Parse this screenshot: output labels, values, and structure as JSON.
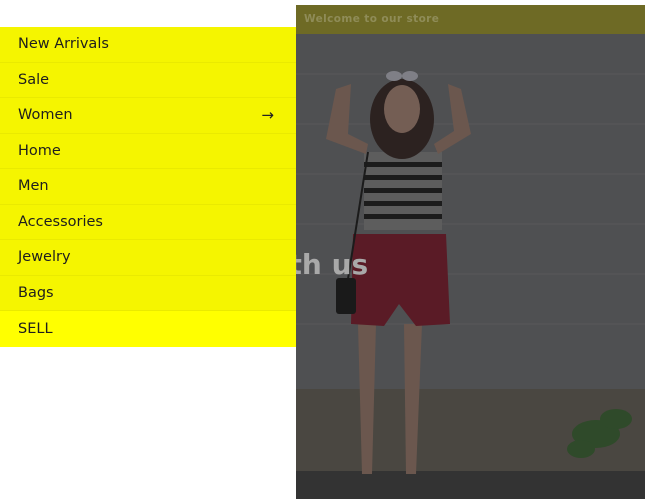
{
  "announcement": {
    "text": "Welcome to our store"
  },
  "hero": {
    "heading": "ess with us"
  },
  "menu": {
    "items": [
      {
        "label": "New Arrivals",
        "has_submenu": false
      },
      {
        "label": "Sale",
        "has_submenu": false
      },
      {
        "label": "Women",
        "has_submenu": true,
        "submenu_icon": "arrow-right-icon"
      },
      {
        "label": "Home",
        "has_submenu": false
      },
      {
        "label": "Men",
        "has_submenu": false
      },
      {
        "label": "Accessories",
        "has_submenu": false
      },
      {
        "label": "Jewelry",
        "has_submenu": false
      },
      {
        "label": "Bags",
        "has_submenu": false
      },
      {
        "label": "SELL",
        "has_submenu": false,
        "active": true
      }
    ]
  },
  "colors": {
    "drawer_bg": "#f5f500",
    "drawer_active": "#ffff00",
    "overlay": "#4d4d4d",
    "announcement_bg": "#6e6a25"
  }
}
